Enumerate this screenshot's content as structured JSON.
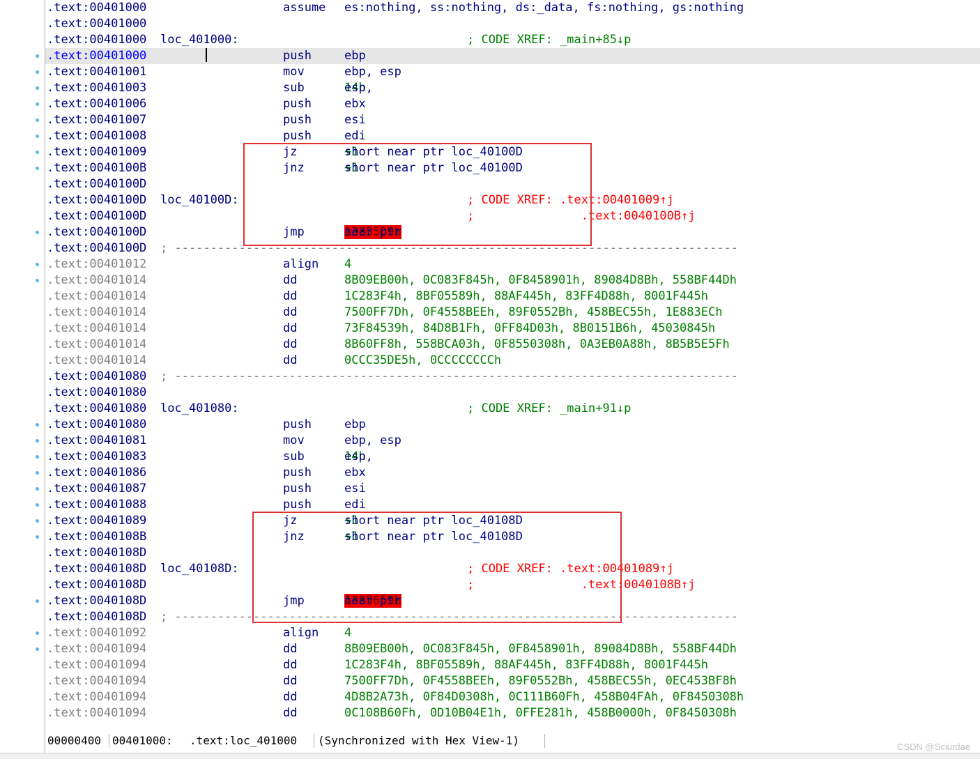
{
  "rows": [
    {
      "addr": ".text:00401000",
      "gray": false,
      "mnem": "assume",
      "ops": [
        {
          "t": "es:nothing, ss:nothing, ds:_data, fs:nothing, gs:nothing"
        }
      ]
    },
    {
      "addr": ".text:00401000",
      "gray": false
    },
    {
      "addr": ".text:00401000",
      "gray": false,
      "label": "loc_401000:",
      "comment": "; CODE XREF: _main+85↓p"
    },
    {
      "addr": ".text:00401000",
      "gray": false,
      "current": true,
      "dot": true,
      "mnem": "push",
      "ops": [
        {
          "t": "ebp"
        }
      ]
    },
    {
      "addr": ".text:00401001",
      "gray": false,
      "dot": true,
      "mnem": "mov",
      "ops": [
        {
          "t": "ebp, esp"
        }
      ]
    },
    {
      "addr": ".text:00401003",
      "gray": false,
      "dot": true,
      "mnem": "sub",
      "ops": [
        {
          "t": "esp, "
        },
        {
          "t": "14h",
          "k": "num"
        }
      ]
    },
    {
      "addr": ".text:00401006",
      "gray": false,
      "dot": true,
      "mnem": "push",
      "ops": [
        {
          "t": "ebx"
        }
      ]
    },
    {
      "addr": ".text:00401007",
      "gray": false,
      "dot": true,
      "mnem": "push",
      "ops": [
        {
          "t": "esi"
        }
      ]
    },
    {
      "addr": ".text:00401008",
      "gray": false,
      "dot": true,
      "mnem": "push",
      "ops": [
        {
          "t": "edi"
        }
      ]
    },
    {
      "addr": ".text:00401009",
      "gray": false,
      "dot": true,
      "mnem": "jz",
      "ops": [
        {
          "t": "short near ptr loc_40100D"
        },
        {
          "t": "+1",
          "k": "num"
        }
      ]
    },
    {
      "addr": ".text:0040100B",
      "gray": false,
      "dot": true,
      "mnem": "jnz",
      "ops": [
        {
          "t": "short near ptr loc_40100D"
        },
        {
          "t": "+1",
          "k": "num"
        }
      ]
    },
    {
      "addr": ".text:0040100D",
      "gray": false
    },
    {
      "addr": ".text:0040100D",
      "gray": false,
      "label": "loc_40100D:",
      "comment": "; CODE XREF: .text:00401009↑j",
      "xref": true
    },
    {
      "addr": ".text:0040100D",
      "gray": false,
      "comment": ";               .text:0040100B↑j",
      "xref": true
    },
    {
      "addr": ".text:0040100D",
      "gray": false,
      "dot": true,
      "mnem": "jmp",
      "ops": [
        {
          "t": "near ptr "
        },
        {
          "t": "13855D9h",
          "k": "err"
        }
      ]
    },
    {
      "addr": ".text:0040100D",
      "gray": false,
      "sep": "; -------------------------------------------------------------------------------"
    },
    {
      "addr": ".text:00401012",
      "gray": true,
      "dot": true,
      "mnem": "align",
      "ops": [
        {
          "t": "4",
          "k": "num"
        }
      ]
    },
    {
      "addr": ".text:00401014",
      "gray": true,
      "dot": true,
      "mnem": "dd",
      "ops": [
        {
          "t": "8B09EB00h, 0C083F845h, 0F8458901h, 89084D8Bh, 558BF44Dh",
          "k": "num"
        }
      ]
    },
    {
      "addr": ".text:00401014",
      "gray": true,
      "mnem": "dd",
      "ops": [
        {
          "t": "1C283F4h, 8BF05589h, 88AF445h, 83FF4D88h, 8001F445h",
          "k": "num"
        }
      ]
    },
    {
      "addr": ".text:00401014",
      "gray": true,
      "mnem": "dd",
      "ops": [
        {
          "t": "7500FF7Dh, 0F4558BEEh, 89F0552Bh, 458BEC55h, 1E883ECh",
          "k": "num"
        }
      ]
    },
    {
      "addr": ".text:00401014",
      "gray": true,
      "mnem": "dd",
      "ops": [
        {
          "t": "73F84539h, 84D8B1Fh, 0FF84D03h, 8B0151B6h, 45030845h",
          "k": "num"
        }
      ]
    },
    {
      "addr": ".text:00401014",
      "gray": true,
      "mnem": "dd",
      "ops": [
        {
          "t": "8B60FF8h, 558BCA03h, 0F8550308h, 0A3EB0A88h, 8B5B5E5Fh",
          "k": "num"
        }
      ]
    },
    {
      "addr": ".text:00401014",
      "gray": true,
      "mnem": "dd",
      "ops": [
        {
          "t": "0CCC35DE5h, 0CCCCCCCCh",
          "k": "num"
        }
      ]
    },
    {
      "addr": ".text:00401080",
      "gray": false,
      "sep": "; -------------------------------------------------------------------------------"
    },
    {
      "addr": ".text:00401080",
      "gray": false
    },
    {
      "addr": ".text:00401080",
      "gray": false,
      "label": "loc_401080:",
      "comment": "; CODE XREF: _main+91↓p"
    },
    {
      "addr": ".text:00401080",
      "gray": false,
      "dot": true,
      "mnem": "push",
      "ops": [
        {
          "t": "ebp"
        }
      ]
    },
    {
      "addr": ".text:00401081",
      "gray": false,
      "dot": true,
      "mnem": "mov",
      "ops": [
        {
          "t": "ebp, esp"
        }
      ]
    },
    {
      "addr": ".text:00401083",
      "gray": false,
      "dot": true,
      "mnem": "sub",
      "ops": [
        {
          "t": "esp, "
        },
        {
          "t": "14h",
          "k": "num"
        }
      ]
    },
    {
      "addr": ".text:00401086",
      "gray": false,
      "dot": true,
      "mnem": "push",
      "ops": [
        {
          "t": "ebx"
        }
      ]
    },
    {
      "addr": ".text:00401087",
      "gray": false,
      "dot": true,
      "mnem": "push",
      "ops": [
        {
          "t": "esi"
        }
      ]
    },
    {
      "addr": ".text:00401088",
      "gray": false,
      "dot": true,
      "mnem": "push",
      "ops": [
        {
          "t": "edi"
        }
      ]
    },
    {
      "addr": ".text:00401089",
      "gray": false,
      "dot": true,
      "mnem": "jz",
      "ops": [
        {
          "t": "short near ptr loc_40108D"
        },
        {
          "t": "+1",
          "k": "num"
        }
      ]
    },
    {
      "addr": ".text:0040108B",
      "gray": false,
      "dot": true,
      "mnem": "jnz",
      "ops": [
        {
          "t": "short near ptr loc_40108D"
        },
        {
          "t": "+1",
          "k": "num"
        }
      ]
    },
    {
      "addr": ".text:0040108D",
      "gray": false
    },
    {
      "addr": ".text:0040108D",
      "gray": false,
      "label": "loc_40108D:",
      "comment": "; CODE XREF: .text:00401089↑j",
      "xref": true
    },
    {
      "addr": ".text:0040108D",
      "gray": false,
      "comment": ";               .text:0040108B↑j",
      "xref": true
    },
    {
      "addr": ".text:0040108D",
      "gray": false,
      "dot": true,
      "mnem": "jmp",
      "ops": [
        {
          "t": "near ptr "
        },
        {
          "t": "1385659h",
          "k": "err"
        }
      ]
    },
    {
      "addr": ".text:0040108D",
      "gray": false,
      "sep": "; -------------------------------------------------------------------------------"
    },
    {
      "addr": ".text:00401092",
      "gray": true,
      "dot": true,
      "mnem": "align",
      "ops": [
        {
          "t": "4",
          "k": "num"
        }
      ]
    },
    {
      "addr": ".text:00401094",
      "gray": true,
      "dot": true,
      "mnem": "dd",
      "ops": [
        {
          "t": "8B09EB00h, 0C083F845h, 0F8458901h, 89084D8Bh, 558BF44Dh",
          "k": "num"
        }
      ]
    },
    {
      "addr": ".text:00401094",
      "gray": true,
      "mnem": "dd",
      "ops": [
        {
          "t": "1C283F4h, 8BF05589h, 88AF445h, 83FF4D88h, 8001F445h",
          "k": "num"
        }
      ]
    },
    {
      "addr": ".text:00401094",
      "gray": true,
      "mnem": "dd",
      "ops": [
        {
          "t": "7500FF7Dh, 0F4558BEEh, 89F0552Bh, 458BEC55h, 0EC453BF8h",
          "k": "num"
        }
      ]
    },
    {
      "addr": ".text:00401094",
      "gray": true,
      "mnem": "dd",
      "ops": [
        {
          "t": "4D8B2A73h, 0F84D0308h, 0C111B60Fh, 458B04FAh, 0F8450308h",
          "k": "num"
        }
      ]
    },
    {
      "addr": ".text:00401094",
      "gray": true,
      "mnem": "dd",
      "ops": [
        {
          "t": "0C108B60Fh, 0D10B04E1h, 0FFE281h, 458B0000h, 0F8450308h",
          "k": "num"
        }
      ]
    }
  ],
  "status": {
    "offset": "00000400",
    "address": "00401000:",
    "location": ".text:loc_401000",
    "sync": "(Synchronized with Hex View-1)"
  },
  "watermark": "CSDN @Sciurdae",
  "colors": {
    "address": "#000080",
    "comment": "#008000",
    "xref_comment": "#ff0000",
    "highlight_box": "#e03030",
    "error_highlight": "#ee0000"
  }
}
